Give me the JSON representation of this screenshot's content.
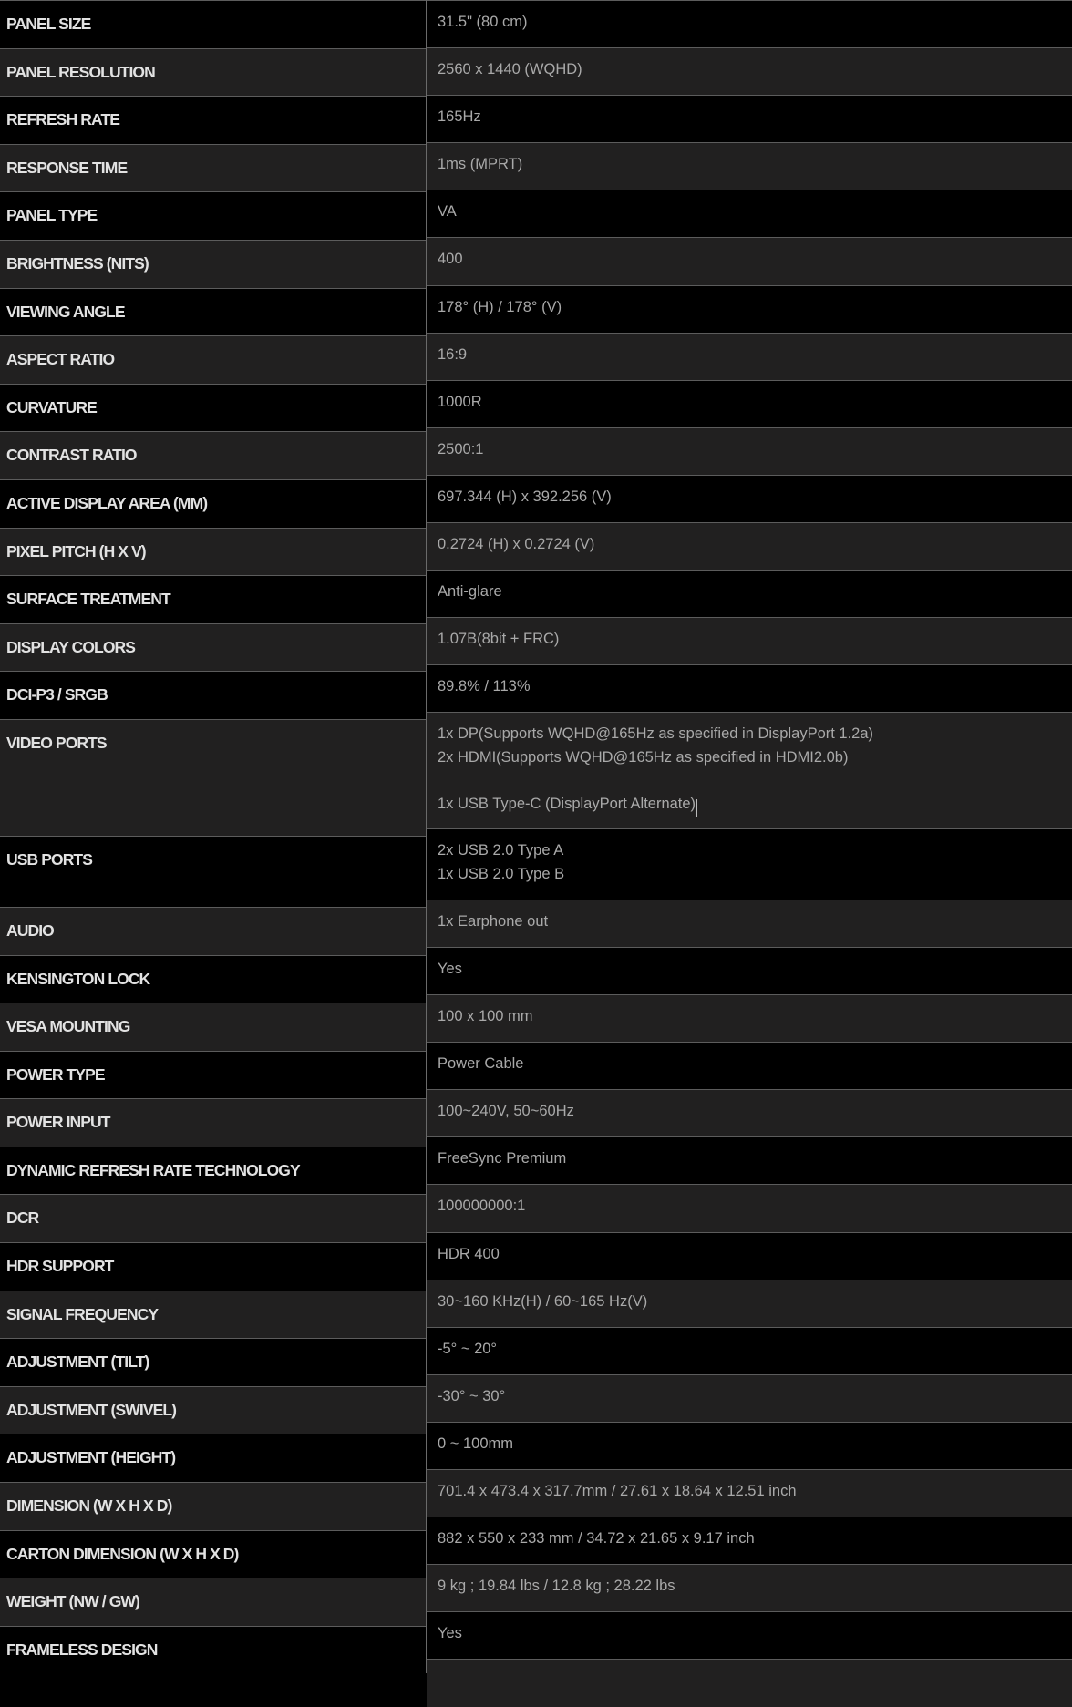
{
  "specs": [
    {
      "label": "PANEL SIZE",
      "value": "31.5\" (80 cm)"
    },
    {
      "label": "PANEL RESOLUTION",
      "value": "2560 x 1440 (WQHD)"
    },
    {
      "label": "REFRESH RATE",
      "value": "165Hz"
    },
    {
      "label": "RESPONSE TIME",
      "value": "1ms (MPRT)"
    },
    {
      "label": "PANEL TYPE",
      "value": "VA"
    },
    {
      "label": "BRIGHTNESS (NITS)",
      "value": "400"
    },
    {
      "label": "VIEWING ANGLE",
      "value": "178° (H) / 178° (V)"
    },
    {
      "label": "ASPECT RATIO",
      "value": "16:9"
    },
    {
      "label": "CURVATURE",
      "value": "1000R"
    },
    {
      "label": "CONTRAST RATIO",
      "value": "2500:1"
    },
    {
      "label": "ACTIVE DISPLAY AREA (MM)",
      "value": "697.344 (H) x 392.256 (V)"
    },
    {
      "label": "PIXEL PITCH (H X V)",
      "value": "0.2724 (H) x 0.2724 (V)"
    },
    {
      "label": "SURFACE TREATMENT",
      "value": "Anti-glare"
    },
    {
      "label": "DISPLAY COLORS",
      "value": "1.07B(8bit + FRC)"
    },
    {
      "label": "DCI-P3 / SRGB",
      "value": "89.8% / 113%"
    },
    {
      "label": "VIDEO PORTS",
      "value": "1x DP(Supports WQHD@165Hz as specified in DisplayPort 1.2a)\n2x HDMI(Supports WQHD@165Hz as specified in HDMI2.0b)\n\n1x USB Type-C (DisplayPort Alternate)",
      "size": "tall"
    },
    {
      "label": "USB PORTS",
      "value": "2x USB 2.0 Type A\n1x USB 2.0 Type B",
      "size": "mid"
    },
    {
      "label": "AUDIO",
      "value": "1x Earphone out"
    },
    {
      "label": "KENSINGTON LOCK",
      "value": "Yes"
    },
    {
      "label": "VESA MOUNTING",
      "value": "100 x 100 mm"
    },
    {
      "label": "POWER TYPE",
      "value": "Power Cable"
    },
    {
      "label": "POWER INPUT",
      "value": "100~240V, 50~60Hz"
    },
    {
      "label": "DYNAMIC REFRESH RATE TECHNOLOGY",
      "value": "FreeSync Premium"
    },
    {
      "label": "DCR",
      "value": "100000000:1"
    },
    {
      "label": "HDR SUPPORT",
      "value": "HDR 400"
    },
    {
      "label": "SIGNAL FREQUENCY",
      "value": "30~160 KHz(H) / 60~165 Hz(V)"
    },
    {
      "label": "ADJUSTMENT (TILT)",
      "value": "-5° ~ 20°"
    },
    {
      "label": "ADJUSTMENT (SWIVEL)",
      "value": "-30° ~ 30°"
    },
    {
      "label": "ADJUSTMENT (HEIGHT)",
      "value": "0 ~ 100mm"
    },
    {
      "label": "DIMENSION (W X H X D)",
      "value": "701.4 x 473.4 x 317.7mm / 27.61 x 18.64 x 12.51 inch"
    },
    {
      "label": "CARTON DIMENSION (W X H X D)",
      "value": "882 x 550 x 233 mm / 34.72 x 21.65 x 9.17 inch"
    },
    {
      "label": "WEIGHT (NW / GW)",
      "value": "9 kg ; 19.84 lbs / 12.8 kg ; 28.22 lbs"
    },
    {
      "label": "FRAMELESS DESIGN",
      "value": "Yes"
    }
  ],
  "text_cursor_row": "VIDEO PORTS",
  "colors": {
    "row_dark": "#000000",
    "row_gray": "#212020",
    "border": "#5c5c5c",
    "label_text": "#e2e2e2",
    "value_text": "#a9a9a9"
  }
}
